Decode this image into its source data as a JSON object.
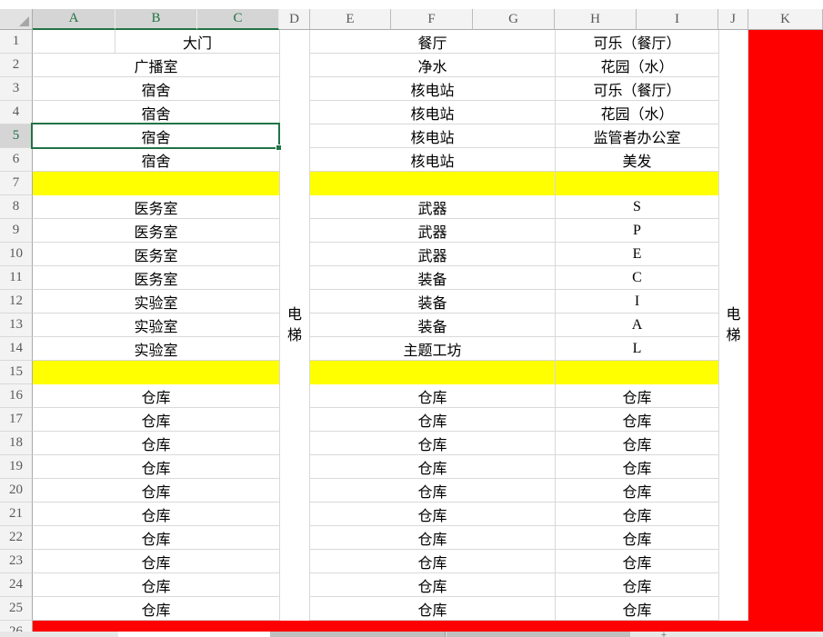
{
  "colors": {
    "yellow_fill": "#FFFF00",
    "red_fill": "#FF0000",
    "selection_green": "#217346",
    "gridline": "#D9D9D9",
    "header_bg": "#F3F3F3",
    "header_selected_bg": "#D5D5D5",
    "header_text": "#595959",
    "cell_text": "#000000",
    "tab_bar_bg": "#E7E7E7",
    "inactive_tab": "#BFBFBF",
    "active_tab": "#FFFFFF"
  },
  "column_headers": [
    "A",
    "B",
    "C",
    "D",
    "E",
    "F",
    "G",
    "H",
    "I",
    "J",
    "K"
  ],
  "selected_columns": [
    "A",
    "B",
    "C"
  ],
  "row_numbers": [
    "1",
    "2",
    "3",
    "4",
    "5",
    "6",
    "7",
    "8",
    "9",
    "10",
    "11",
    "12",
    "13",
    "14",
    "15",
    "16",
    "17",
    "18",
    "19",
    "20",
    "21",
    "22",
    "23",
    "24",
    "25"
  ],
  "selected_row": "5",
  "partial_row_number": "26",
  "grid": {
    "band_abc": [
      {
        "t": "大门",
        "splitA": true
      },
      {
        "t": "广播室"
      },
      {
        "t": "宿舍"
      },
      {
        "t": "宿舍"
      },
      {
        "t": "宿舍",
        "sel": true
      },
      {
        "t": "宿舍"
      },
      {
        "f": "y"
      },
      {
        "t": "医务室"
      },
      {
        "t": "医务室"
      },
      {
        "t": "医务室"
      },
      {
        "t": "医务室"
      },
      {
        "t": "实验室"
      },
      {
        "t": "实验室"
      },
      {
        "t": "实验室"
      },
      {
        "f": "y"
      },
      {
        "t": "仓库"
      },
      {
        "t": "仓库"
      },
      {
        "t": "仓库"
      },
      {
        "t": "仓库"
      },
      {
        "t": "仓库"
      },
      {
        "t": "仓库"
      },
      {
        "t": "仓库"
      },
      {
        "t": "仓库"
      },
      {
        "t": "仓库"
      },
      {
        "t": "仓库"
      }
    ],
    "band_efg": [
      {
        "t": "餐厅"
      },
      {
        "t": "净水"
      },
      {
        "t": "核电站"
      },
      {
        "t": "核电站"
      },
      {
        "t": "核电站"
      },
      {
        "t": "核电站"
      },
      {
        "f": "y"
      },
      {
        "t": "武器"
      },
      {
        "t": "武器"
      },
      {
        "t": "武器"
      },
      {
        "t": "装备"
      },
      {
        "t": "装备"
      },
      {
        "t": "装备"
      },
      {
        "t": "主题工坊"
      },
      {
        "f": "y"
      },
      {
        "t": "仓库"
      },
      {
        "t": "仓库"
      },
      {
        "t": "仓库"
      },
      {
        "t": "仓库"
      },
      {
        "t": "仓库"
      },
      {
        "t": "仓库"
      },
      {
        "t": "仓库"
      },
      {
        "t": "仓库"
      },
      {
        "t": "仓库"
      },
      {
        "t": "仓库"
      }
    ],
    "band_hi": [
      {
        "t": "可乐（餐厅）"
      },
      {
        "t": "花园（水）"
      },
      {
        "t": "可乐（餐厅）"
      },
      {
        "t": "花园（水）"
      },
      {
        "t": "监管者办公室"
      },
      {
        "t": "美发"
      },
      {
        "f": "y"
      },
      {
        "t": "S"
      },
      {
        "t": "P"
      },
      {
        "t": "E"
      },
      {
        "t": "C"
      },
      {
        "t": "I"
      },
      {
        "t": "A"
      },
      {
        "t": "L"
      },
      {
        "f": "y"
      },
      {
        "t": "仓库"
      },
      {
        "t": "仓库"
      },
      {
        "t": "仓库"
      },
      {
        "t": "仓库"
      },
      {
        "t": "仓库"
      },
      {
        "t": "仓库"
      },
      {
        "t": "仓库"
      },
      {
        "t": "仓库"
      },
      {
        "t": "仓库"
      },
      {
        "t": "仓库"
      }
    ],
    "col_d_vertical_text": "电梯",
    "col_j_vertical_text": "电梯",
    "col_k_fill": "red",
    "row_26_fill": "red"
  },
  "sheet_tab_bar": {
    "tabs": [
      {
        "role": "active"
      },
      {
        "role": "inactive"
      },
      {
        "role": "inactive"
      }
    ],
    "add_button": "+"
  }
}
